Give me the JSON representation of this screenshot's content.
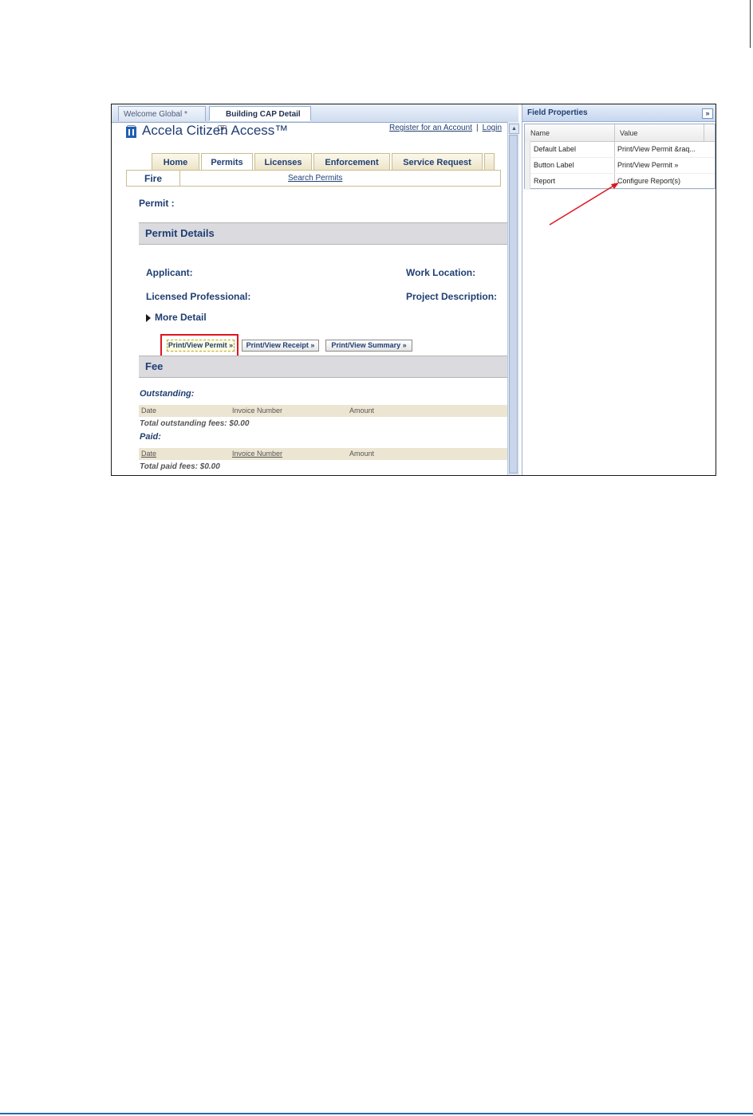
{
  "tabs": [
    {
      "label": "Welcome Global *",
      "active": false
    },
    {
      "label": "Building CAP Detail",
      "active": true
    }
  ],
  "app": {
    "title": "Accela Citizen Access™",
    "register_link": "Register for an Account",
    "separator": "|",
    "login_link": "Login"
  },
  "nav": {
    "tabs": [
      "Home",
      "Permits",
      "Licenses",
      "Enforcement",
      "Service Request"
    ],
    "active": "Permits",
    "subtab": "Fire",
    "search_link": "Search Permits"
  },
  "permit": {
    "label": "Permit :",
    "details_heading": "Permit Details",
    "applicant": "Applicant:",
    "work_location": "Work Location:",
    "licensed_professional": "Licensed Professional:",
    "project_description": "Project Description:",
    "more_detail": "More Detail"
  },
  "buttons": {
    "print_permit": "Print/View Permit »",
    "print_receipt": "Print/View Receipt »",
    "print_summary": "Print/View Summary »"
  },
  "fee": {
    "heading": "Fee",
    "outstanding_label": "Outstanding:",
    "paid_label": "Paid:",
    "columns": [
      "Date",
      "Invoice Number",
      "Amount"
    ],
    "total_outstanding": "Total outstanding fees: $0.00",
    "total_paid": "Total paid fees: $0.00"
  },
  "field_properties": {
    "title": "Field Properties",
    "collapse_glyph": "»",
    "columns": [
      "Name",
      "Value"
    ],
    "rows": [
      {
        "name": "Default Label",
        "value": "Print/View Permit &raq..."
      },
      {
        "name": "Button Label",
        "value": "Print/View Permit »"
      },
      {
        "name": "Report",
        "value": "Configure Report(s)"
      }
    ]
  },
  "colors": {
    "highlight_box": "#e0141e",
    "arrow": "#e0141e",
    "link_blue": "#1f3e72"
  }
}
